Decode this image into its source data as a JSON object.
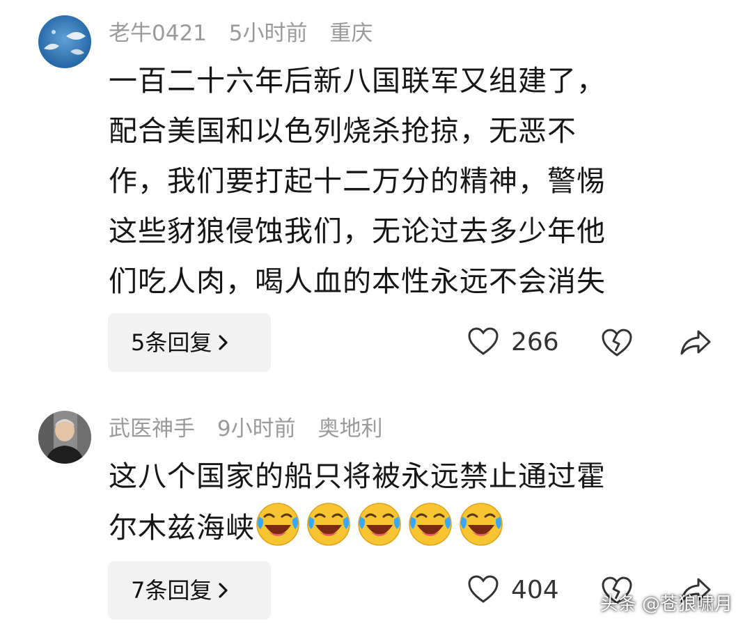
{
  "comments": [
    {
      "author": "老牛0421",
      "time": "5小时前",
      "location": "重庆",
      "lines": [
        "一百二十六年后新八国联军又组建了，",
        "配合美国和以色列烧杀抢掠，无恶不",
        "作，我们要打起十二万分的精神，警惕",
        "这些豺狼侵蚀我们，无论过去多少年他",
        "们吃人肉，喝人血的本性永远不会消失"
      ],
      "reply_label": "5条回复",
      "likes": "266",
      "avatar_icon": "fish-avatar"
    },
    {
      "author": "武医神手",
      "time": "9小时前",
      "location": "奥地利",
      "lines": [
        "这八个国家的船只将被永远禁止通过霍",
        "尔木兹海峡"
      ],
      "emoji": "laughing-crying-emoji",
      "emoji_count": 5,
      "reply_label": "7条回复",
      "likes": "404",
      "avatar_icon": "man-avatar"
    }
  ],
  "watermark": "头条 @苍狼啸月",
  "colors": {
    "meta": "#9a9a9a",
    "reply_bg": "#f2f2f2",
    "icon": "#333333"
  }
}
